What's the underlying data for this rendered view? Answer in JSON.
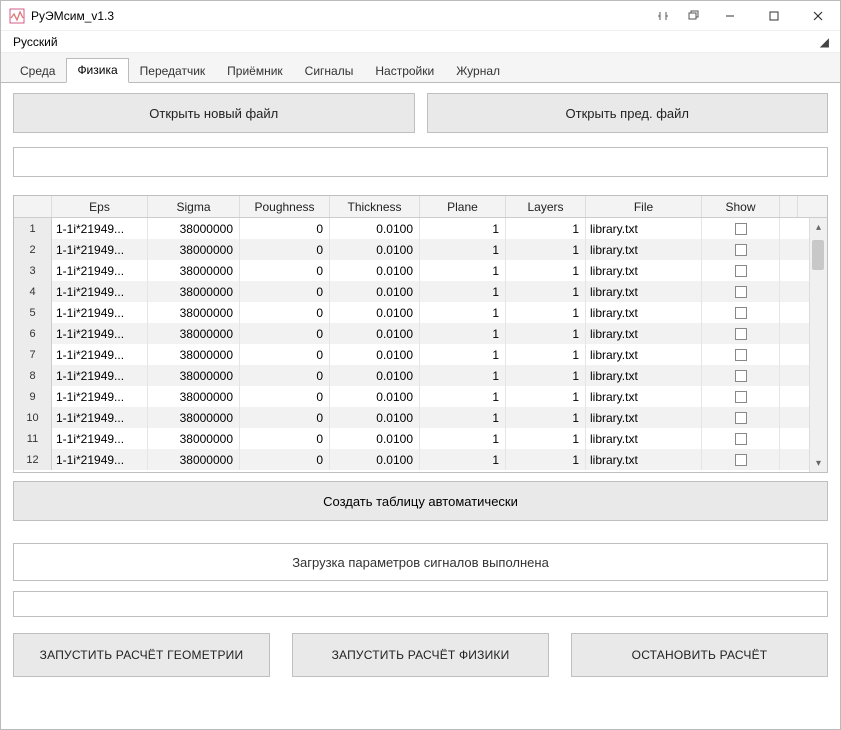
{
  "window": {
    "title": "РуЭМсим_v1.3"
  },
  "menu": {
    "language": "Русский"
  },
  "tabs": [
    {
      "label": "Среда",
      "active": false
    },
    {
      "label": "Физика",
      "active": true
    },
    {
      "label": "Передатчик",
      "active": false
    },
    {
      "label": "Приёмник",
      "active": false
    },
    {
      "label": "Сигналы",
      "active": false
    },
    {
      "label": "Настройки",
      "active": false
    },
    {
      "label": "Журнал",
      "active": false
    }
  ],
  "buttons": {
    "open_new": "Открыть новый файл",
    "open_prev": "Открыть пред. файл",
    "auto_table": "Создать таблицу автоматически",
    "run_geometry": "ЗАПУСТИТЬ РАСЧЁТ ГЕОМЕТРИИ",
    "run_physics": "ЗАПУСТИТЬ РАСЧЁТ ФИЗИКИ",
    "stop_calc": "ОСТАНОВИТЬ РАСЧЁТ"
  },
  "table": {
    "headers": {
      "eps": "Eps",
      "sigma": "Sigma",
      "poughness": "Poughness",
      "thickness": "Thickness",
      "plane": "Plane",
      "layers": "Layers",
      "file": "File",
      "show": "Show"
    },
    "rows": [
      {
        "n": "1",
        "eps": "1-1i*21949...",
        "sigma": "38000000",
        "poughness": "0",
        "thickness": "0.0100",
        "plane": "1",
        "layers": "1",
        "file": "library.txt",
        "show": false
      },
      {
        "n": "2",
        "eps": "1-1i*21949...",
        "sigma": "38000000",
        "poughness": "0",
        "thickness": "0.0100",
        "plane": "1",
        "layers": "1",
        "file": "library.txt",
        "show": false
      },
      {
        "n": "3",
        "eps": "1-1i*21949...",
        "sigma": "38000000",
        "poughness": "0",
        "thickness": "0.0100",
        "plane": "1",
        "layers": "1",
        "file": "library.txt",
        "show": false
      },
      {
        "n": "4",
        "eps": "1-1i*21949...",
        "sigma": "38000000",
        "poughness": "0",
        "thickness": "0.0100",
        "plane": "1",
        "layers": "1",
        "file": "library.txt",
        "show": false
      },
      {
        "n": "5",
        "eps": "1-1i*21949...",
        "sigma": "38000000",
        "poughness": "0",
        "thickness": "0.0100",
        "plane": "1",
        "layers": "1",
        "file": "library.txt",
        "show": false
      },
      {
        "n": "6",
        "eps": "1-1i*21949...",
        "sigma": "38000000",
        "poughness": "0",
        "thickness": "0.0100",
        "plane": "1",
        "layers": "1",
        "file": "library.txt",
        "show": false
      },
      {
        "n": "7",
        "eps": "1-1i*21949...",
        "sigma": "38000000",
        "poughness": "0",
        "thickness": "0.0100",
        "plane": "1",
        "layers": "1",
        "file": "library.txt",
        "show": false
      },
      {
        "n": "8",
        "eps": "1-1i*21949...",
        "sigma": "38000000",
        "poughness": "0",
        "thickness": "0.0100",
        "plane": "1",
        "layers": "1",
        "file": "library.txt",
        "show": false
      },
      {
        "n": "9",
        "eps": "1-1i*21949...",
        "sigma": "38000000",
        "poughness": "0",
        "thickness": "0.0100",
        "plane": "1",
        "layers": "1",
        "file": "library.txt",
        "show": false
      },
      {
        "n": "10",
        "eps": "1-1i*21949...",
        "sigma": "38000000",
        "poughness": "0",
        "thickness": "0.0100",
        "plane": "1",
        "layers": "1",
        "file": "library.txt",
        "show": false
      },
      {
        "n": "11",
        "eps": "1-1i*21949...",
        "sigma": "38000000",
        "poughness": "0",
        "thickness": "0.0100",
        "plane": "1",
        "layers": "1",
        "file": "library.txt",
        "show": false
      },
      {
        "n": "12",
        "eps": "1-1i*21949...",
        "sigma": "38000000",
        "poughness": "0",
        "thickness": "0.0100",
        "plane": "1",
        "layers": "1",
        "file": "library.txt",
        "show": false
      }
    ]
  },
  "status": {
    "message": "Загрузка параметров сигналов выполнена"
  }
}
